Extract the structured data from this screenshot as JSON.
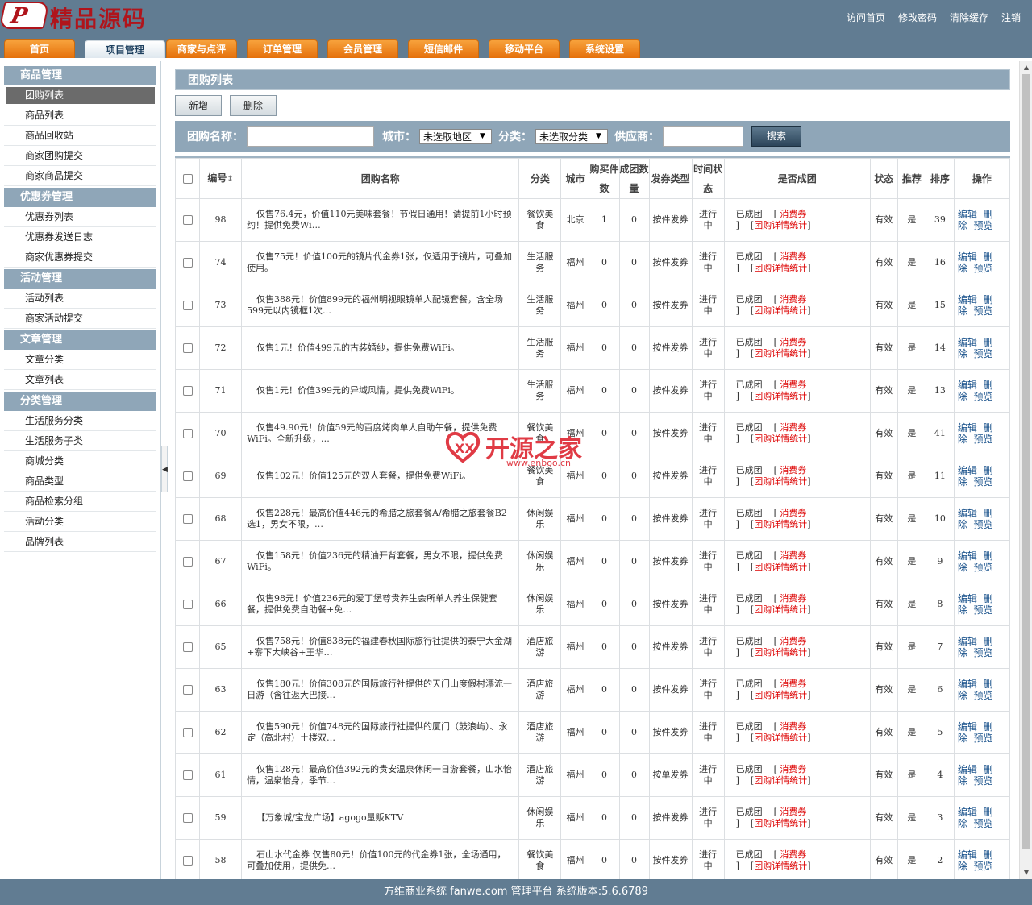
{
  "brand": {
    "logo_text": "精品源码",
    "logo_mark": "P"
  },
  "top_links": [
    "访问首页",
    "修改密码",
    "清除缓存",
    "注销"
  ],
  "nav_tabs": [
    "首页",
    "项目管理",
    "商家与点评",
    "订单管理",
    "会员管理",
    "短信邮件",
    "移动平台",
    "系统设置"
  ],
  "sidebar": [
    {
      "title": "商品管理",
      "items": [
        "团购列表",
        "商品列表",
        "商品回收站",
        "商家团购提交",
        "商家商品提交"
      ]
    },
    {
      "title": "优惠券管理",
      "items": [
        "优惠券列表",
        "优惠券发送日志",
        "商家优惠券提交"
      ]
    },
    {
      "title": "活动管理",
      "items": [
        "活动列表",
        "商家活动提交"
      ]
    },
    {
      "title": "文章管理",
      "items": [
        "文章分类",
        "文章列表"
      ]
    },
    {
      "title": "分类管理",
      "items": [
        "生活服务分类",
        "生活服务子类",
        "商城分类",
        "商品类型",
        "商品检索分组",
        "活动分类",
        "品牌列表"
      ]
    }
  ],
  "section_title": "团购列表",
  "actions": {
    "add": "新增",
    "delete": "删除"
  },
  "filter": {
    "name_label": "团购名称：",
    "city_label": "城市：",
    "city_value": "未选取地区",
    "category_label": "分类：",
    "category_value": "未选取分类",
    "supplier_label": "供应商：",
    "search_button": "搜索"
  },
  "table": {
    "headers": {
      "id": "编号",
      "name": "团购名称",
      "category": "分类",
      "city": "城市",
      "buy_count": "购买件数",
      "group_count": "成团数量",
      "coupon_type": "发券类型",
      "time_status": "时间状态",
      "grouped": "是否成团",
      "status": "状态",
      "recommend": "推荐",
      "sort": "排序",
      "ops": "操作"
    },
    "sort_icon": "↕",
    "rows": [
      {
        "id": "98",
        "name": "仅售76.4元，价值110元美味套餐！节假日通用！请提前1小时预约！提供免费Wi…",
        "category": "餐饮美食",
        "city": "北京",
        "buy": "1",
        "group": "0",
        "coupon": "按件发券",
        "time": "进行中",
        "grouped": "已成团",
        "consume": "消费券",
        "stats": "团购详情统计",
        "status": "有效",
        "recommend": "是",
        "sort": "39"
      },
      {
        "id": "74",
        "name": "仅售75元！价值100元的镜片代金券1张，仅适用于镜片，可叠加使用。",
        "category": "生活服务",
        "city": "福州",
        "buy": "0",
        "group": "0",
        "coupon": "按件发券",
        "time": "进行中",
        "grouped": "已成团",
        "consume": "消费券",
        "stats": "团购详情统计",
        "status": "有效",
        "recommend": "是",
        "sort": "16"
      },
      {
        "id": "73",
        "name": "仅售388元！价值899元的福州明视眼镜单人配镜套餐，含全场599元以内镜框1次…",
        "category": "生活服务",
        "city": "福州",
        "buy": "0",
        "group": "0",
        "coupon": "按件发券",
        "time": "进行中",
        "grouped": "已成团",
        "consume": "消费券",
        "stats": "团购详情统计",
        "status": "有效",
        "recommend": "是",
        "sort": "15"
      },
      {
        "id": "72",
        "name": "仅售1元！价值499元的古装婚纱，提供免费WiFi。",
        "category": "生活服务",
        "city": "福州",
        "buy": "0",
        "group": "0",
        "coupon": "按件发券",
        "time": "进行中",
        "grouped": "已成团",
        "consume": "消费券",
        "stats": "团购详情统计",
        "status": "有效",
        "recommend": "是",
        "sort": "14"
      },
      {
        "id": "71",
        "name": "仅售1元！价值399元的异域风情，提供免费WiFi。",
        "category": "生活服务",
        "city": "福州",
        "buy": "0",
        "group": "0",
        "coupon": "按件发券",
        "time": "进行中",
        "grouped": "已成团",
        "consume": "消费券",
        "stats": "团购详情统计",
        "status": "有效",
        "recommend": "是",
        "sort": "13"
      },
      {
        "id": "70",
        "name": "仅售49.90元！价值59元的百度烤肉单人自助午餐，提供免费WiFi。全新升级，…",
        "category": "餐饮美食",
        "city": "福州",
        "buy": "0",
        "group": "0",
        "coupon": "按件发券",
        "time": "进行中",
        "grouped": "已成团",
        "consume": "消费券",
        "stats": "团购详情统计",
        "status": "有效",
        "recommend": "是",
        "sort": "41"
      },
      {
        "id": "69",
        "name": "仅售102元！价值125元的双人套餐，提供免费WiFi。",
        "category": "餐饮美食",
        "city": "福州",
        "buy": "0",
        "group": "0",
        "coupon": "按件发券",
        "time": "进行中",
        "grouped": "已成团",
        "consume": "消费券",
        "stats": "团购详情统计",
        "status": "有效",
        "recommend": "是",
        "sort": "11"
      },
      {
        "id": "68",
        "name": "仅售228元！最高价值446元的希腊之旅套餐A/希腊之旅套餐B2选1，男女不限，…",
        "category": "休闲娱乐",
        "city": "福州",
        "buy": "0",
        "group": "0",
        "coupon": "按件发券",
        "time": "进行中",
        "grouped": "已成团",
        "consume": "消费券",
        "stats": "团购详情统计",
        "status": "有效",
        "recommend": "是",
        "sort": "10"
      },
      {
        "id": "67",
        "name": "仅售158元！价值236元的精油开背套餐，男女不限，提供免费WiFi。",
        "category": "休闲娱乐",
        "city": "福州",
        "buy": "0",
        "group": "0",
        "coupon": "按件发券",
        "time": "进行中",
        "grouped": "已成团",
        "consume": "消费券",
        "stats": "团购详情统计",
        "status": "有效",
        "recommend": "是",
        "sort": "9"
      },
      {
        "id": "66",
        "name": "仅售98元！价值236元的爱丁堡尊贵养生会所单人养生保健套餐，提供免费自助餐+免…",
        "category": "休闲娱乐",
        "city": "福州",
        "buy": "0",
        "group": "0",
        "coupon": "按件发券",
        "time": "进行中",
        "grouped": "已成团",
        "consume": "消费券",
        "stats": "团购详情统计",
        "status": "有效",
        "recommend": "是",
        "sort": "8"
      },
      {
        "id": "65",
        "name": "仅售758元！价值838元的福建春秋国际旅行社提供的泰宁大金湖+寨下大峡谷+王华…",
        "category": "酒店旅游",
        "city": "福州",
        "buy": "0",
        "group": "0",
        "coupon": "按件发券",
        "time": "进行中",
        "grouped": "已成团",
        "consume": "消费券",
        "stats": "团购详情统计",
        "status": "有效",
        "recommend": "是",
        "sort": "7"
      },
      {
        "id": "63",
        "name": "仅售180元！价值308元的国际旅行社提供的天门山度假村漂流一日游（含往返大巴接…",
        "category": "酒店旅游",
        "city": "福州",
        "buy": "0",
        "group": "0",
        "coupon": "按件发券",
        "time": "进行中",
        "grouped": "已成团",
        "consume": "消费券",
        "stats": "团购详情统计",
        "status": "有效",
        "recommend": "是",
        "sort": "6"
      },
      {
        "id": "62",
        "name": "仅售590元！价值748元的国际旅行社提供的厦门（鼓浪屿）、永定（高北村）土楼双…",
        "category": "酒店旅游",
        "city": "福州",
        "buy": "0",
        "group": "0",
        "coupon": "按件发券",
        "time": "进行中",
        "grouped": "已成团",
        "consume": "消费券",
        "stats": "团购详情统计",
        "status": "有效",
        "recommend": "是",
        "sort": "5"
      },
      {
        "id": "61",
        "name": "仅售128元！最高价值392元的贵安温泉休闲一日游套餐，山水怡情，温泉怡身，季节…",
        "category": "酒店旅游",
        "city": "福州",
        "buy": "0",
        "group": "0",
        "coupon": "按单发券",
        "time": "进行中",
        "grouped": "已成团",
        "consume": "消费券",
        "stats": "团购详情统计",
        "status": "有效",
        "recommend": "是",
        "sort": "4"
      },
      {
        "id": "59",
        "name": "【万象城/宝龙广场】agogo量贩KTV",
        "category": "休闲娱乐",
        "city": "福州",
        "buy": "0",
        "group": "0",
        "coupon": "按件发券",
        "time": "进行中",
        "grouped": "已成团",
        "consume": "消费券",
        "stats": "团购详情统计",
        "status": "有效",
        "recommend": "是",
        "sort": "3"
      },
      {
        "id": "58",
        "name": "石山水代金券 仅售80元！价值100元的代金券1张，全场通用，可叠加使用，提供免…",
        "category": "餐饮美食",
        "city": "福州",
        "buy": "0",
        "group": "0",
        "coupon": "按件发券",
        "time": "进行中",
        "grouped": "已成团",
        "consume": "消费券",
        "stats": "团购详情统计",
        "status": "有效",
        "recommend": "是",
        "sort": "2"
      }
    ],
    "row_ops": [
      "编辑",
      "删除",
      "预览"
    ]
  },
  "watermark": {
    "text": "开源之家",
    "url": "www.enboo.cn"
  },
  "footer": "方维商业系统 fanwe.com 管理平台 系统版本:5.6.6789",
  "colors": {
    "header_bg": "#617c92",
    "tab_orange": "#f08a1f",
    "panel_bg": "#8fa6b8",
    "link_red": "#dd0000",
    "link_blue": "#17508a"
  }
}
